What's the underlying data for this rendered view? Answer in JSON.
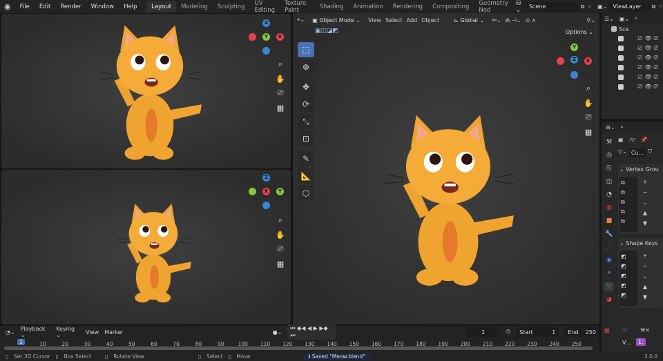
{
  "topbar": {
    "menus": [
      "File",
      "Edit",
      "Render",
      "Window",
      "Help"
    ],
    "workspaces": [
      "Layout",
      "Modeling",
      "Sculpting",
      "UV Editing",
      "Texture Paint",
      "Shading",
      "Animation",
      "Rendering",
      "Compositing",
      "Geometry Nod"
    ],
    "scene": "Scene",
    "view_layer": "ViewLayer"
  },
  "viewport": {
    "mode": "Object Mode",
    "menus": [
      "View",
      "Select",
      "Add",
      "Object"
    ],
    "orientation": "Global",
    "options": "Options"
  },
  "gizmo": {
    "x": "X",
    "y": "Y",
    "z": "Z"
  },
  "outliner": {
    "scene_label": "Sce"
  },
  "properties": {
    "data_name": "Cu...",
    "vertex_groups": "Vertex Grou",
    "shape_keys": "Shape Keys"
  },
  "timeline": {
    "menus": [
      "Playback",
      "Keying",
      "View",
      "Marker"
    ],
    "current_frame": "1",
    "start_label": "Start",
    "start": "1",
    "end_label": "End",
    "end": "250",
    "ticks": [
      "10",
      "20",
      "30",
      "40",
      "50",
      "60",
      "70",
      "80",
      "90",
      "100",
      "110",
      "120",
      "130",
      "140",
      "150",
      "160",
      "170",
      "180",
      "190",
      "200",
      "210",
      "220",
      "230",
      "240",
      "250"
    ],
    "playhead": "1",
    "side_v": "V...",
    "side_num": "1."
  },
  "status": {
    "set_cursor": "Set 3D Cursor",
    "box_select": "Box Select",
    "rotate_view": "Rotate View",
    "select": "Select",
    "move": "Move",
    "message": "Saved \"Meow.blend\"",
    "version": "3.0.0"
  },
  "colors": {
    "accent": "#4772b3",
    "x_axis": "#e8414e",
    "y_axis": "#8bc540",
    "z_axis": "#3b84d4",
    "cat": "#f0a430"
  }
}
